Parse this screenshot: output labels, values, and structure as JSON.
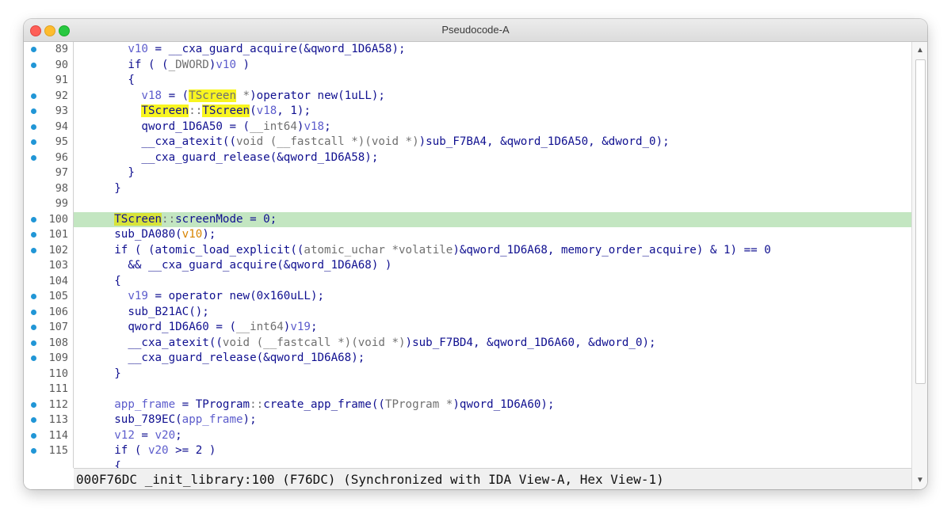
{
  "window": {
    "title": "Pseudocode-A"
  },
  "lines": [
    {
      "num": "89",
      "dot": true,
      "tokens": [
        {
          "t": "        "
        },
        {
          "t": "v10",
          "c": "var"
        },
        {
          "t": " = __cxa_guard_acquire(&qword_1D6A58);"
        }
      ]
    },
    {
      "num": "90",
      "dot": true,
      "tokens": [
        {
          "t": "        if ( ("
        },
        {
          "t": "_DWORD",
          "c": "gray"
        },
        {
          "t": ")"
        },
        {
          "t": "v10",
          "c": "var"
        },
        {
          "t": " )"
        }
      ]
    },
    {
      "num": "91",
      "dot": false,
      "tokens": [
        {
          "t": "        {"
        }
      ]
    },
    {
      "num": "92",
      "dot": true,
      "tokens": [
        {
          "t": "          "
        },
        {
          "t": "v18",
          "c": "var"
        },
        {
          "t": " = ("
        },
        {
          "t": "TScreen",
          "c": "gray hl"
        },
        {
          "t": " *",
          "c": "gray"
        },
        {
          "t": ")operator new(1uLL);"
        }
      ]
    },
    {
      "num": "93",
      "dot": true,
      "tokens": [
        {
          "t": "          "
        },
        {
          "t": "TScreen",
          "c": "hl"
        },
        {
          "t": "::",
          "c": "gray"
        },
        {
          "t": "TScreen",
          "c": "hl"
        },
        {
          "t": "("
        },
        {
          "t": "v18",
          "c": "var"
        },
        {
          "t": ", 1);"
        }
      ]
    },
    {
      "num": "94",
      "dot": true,
      "tokens": [
        {
          "t": "          qword_1D6A50 = ("
        },
        {
          "t": "__int64",
          "c": "gray"
        },
        {
          "t": ")"
        },
        {
          "t": "v18",
          "c": "var"
        },
        {
          "t": ";"
        }
      ]
    },
    {
      "num": "95",
      "dot": true,
      "tokens": [
        {
          "t": "          __cxa_atexit(("
        },
        {
          "t": "void (__fastcall *)(void *)",
          "c": "gray"
        },
        {
          "t": ")sub_F7BA4, &qword_1D6A50, &dword_0);"
        }
      ]
    },
    {
      "num": "96",
      "dot": true,
      "tokens": [
        {
          "t": "          __cxa_guard_release(&qword_1D6A58);"
        }
      ]
    },
    {
      "num": "97",
      "dot": false,
      "tokens": [
        {
          "t": "        }"
        }
      ]
    },
    {
      "num": "98",
      "dot": false,
      "tokens": [
        {
          "t": "      }"
        }
      ]
    },
    {
      "num": "99",
      "dot": false,
      "tokens": [
        {
          "t": ""
        }
      ]
    },
    {
      "num": "100",
      "dot": true,
      "active": true,
      "tokens": [
        {
          "t": "      "
        },
        {
          "t": "TScreen",
          "c": "hldark"
        },
        {
          "t": "::",
          "c": "gray"
        },
        {
          "t": "screenMode = 0;"
        }
      ]
    },
    {
      "num": "101",
      "dot": true,
      "tokens": [
        {
          "t": "      sub_DA080("
        },
        {
          "t": "v10",
          "c": "orange"
        },
        {
          "t": ");"
        }
      ]
    },
    {
      "num": "102",
      "dot": true,
      "tokens": [
        {
          "t": "      if ( (atomic_load_explicit(("
        },
        {
          "t": "atomic_uchar *volatile",
          "c": "gray"
        },
        {
          "t": ")&qword_1D6A68, memory_order_acquire) & 1) == 0"
        }
      ]
    },
    {
      "num": "103",
      "dot": false,
      "tokens": [
        {
          "t": "        && __cxa_guard_acquire(&qword_1D6A68) )"
        }
      ]
    },
    {
      "num": "104",
      "dot": false,
      "tokens": [
        {
          "t": "      {"
        }
      ]
    },
    {
      "num": "105",
      "dot": true,
      "tokens": [
        {
          "t": "        "
        },
        {
          "t": "v19",
          "c": "var"
        },
        {
          "t": " = operator new(0x160uLL);"
        }
      ]
    },
    {
      "num": "106",
      "dot": true,
      "tokens": [
        {
          "t": "        sub_B21AC();"
        }
      ]
    },
    {
      "num": "107",
      "dot": true,
      "tokens": [
        {
          "t": "        qword_1D6A60 = ("
        },
        {
          "t": "__int64",
          "c": "gray"
        },
        {
          "t": ")"
        },
        {
          "t": "v19",
          "c": "var"
        },
        {
          "t": ";"
        }
      ]
    },
    {
      "num": "108",
      "dot": true,
      "tokens": [
        {
          "t": "        __cxa_atexit(("
        },
        {
          "t": "void (__fastcall *)(void *)",
          "c": "gray"
        },
        {
          "t": ")sub_F7BD4, &qword_1D6A60, &dword_0);"
        }
      ]
    },
    {
      "num": "109",
      "dot": true,
      "tokens": [
        {
          "t": "        __cxa_guard_release(&qword_1D6A68);"
        }
      ]
    },
    {
      "num": "110",
      "dot": false,
      "tokens": [
        {
          "t": "      }"
        }
      ]
    },
    {
      "num": "111",
      "dot": false,
      "tokens": [
        {
          "t": ""
        }
      ]
    },
    {
      "num": "112",
      "dot": true,
      "tokens": [
        {
          "t": "      "
        },
        {
          "t": "app_frame",
          "c": "var"
        },
        {
          "t": " = TProgram"
        },
        {
          "t": "::",
          "c": "gray"
        },
        {
          "t": "create_app_frame(("
        },
        {
          "t": "TProgram *",
          "c": "gray"
        },
        {
          "t": ")qword_1D6A60);"
        }
      ]
    },
    {
      "num": "113",
      "dot": true,
      "tokens": [
        {
          "t": "      sub_789EC("
        },
        {
          "t": "app_frame",
          "c": "var"
        },
        {
          "t": ");"
        }
      ]
    },
    {
      "num": "114",
      "dot": true,
      "tokens": [
        {
          "t": "      "
        },
        {
          "t": "v12",
          "c": "var"
        },
        {
          "t": " = "
        },
        {
          "t": "v20",
          "c": "var"
        },
        {
          "t": ";"
        }
      ]
    },
    {
      "num": "115",
      "dot": true,
      "tokens": [
        {
          "t": "      if ( "
        },
        {
          "t": "v20",
          "c": "var"
        },
        {
          "t": " >= 2 )"
        }
      ]
    },
    {
      "num": "",
      "dot": false,
      "tokens": [
        {
          "t": "      {"
        }
      ]
    }
  ],
  "status": {
    "text": "000F76DC _init_library:100 (F76DC) (Synchronized with IDA View-A, Hex View-1)"
  },
  "scrollbar": {
    "up_icon": "▲",
    "down_icon": "▼"
  },
  "colors": {
    "accent_dot": "#2196d6",
    "active_line": "#c3e6c1",
    "highlight": "#f8f520",
    "code_text": "#101090",
    "variable": "#5c5ccc",
    "cast_gray": "#707070",
    "argument_orange": "#d88400"
  }
}
